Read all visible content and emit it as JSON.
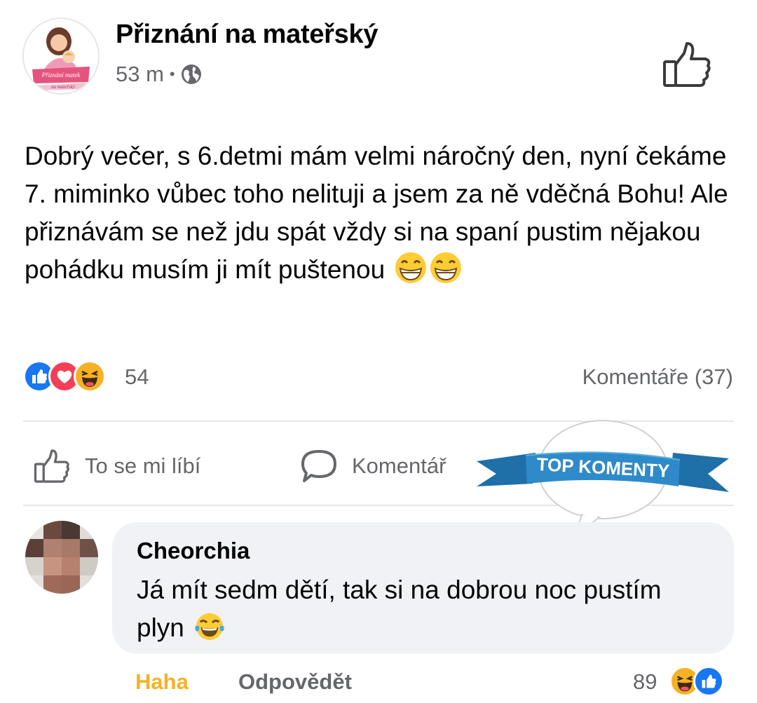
{
  "header": {
    "page_name": "Přiznání na mateřský",
    "time": "53 m",
    "separator": "•",
    "privacy_icon": "globe-icon",
    "logo_text_line1": "Přiznání matek",
    "logo_text_line2": "na mateřský"
  },
  "post": {
    "text": "Dobrý večer, s 6.detmi mám velmi náročný den, nyní čekáme 7. miminko vůbec toho nelituji a jsem za ně vděčná Bohu! Ale přiznávám se než jdu spát vždy si na spaní pustim nějakou pohádku musím ji mít puštenou",
    "emoji": [
      "grinning-face-icon",
      "grinning-face-icon"
    ]
  },
  "reactions": {
    "icons": [
      "like-reaction-icon",
      "love-reaction-icon",
      "haha-reaction-icon"
    ],
    "count": "54",
    "comments_label": "Komentáře (37)"
  },
  "actions": {
    "like_label": "To se mi líbí",
    "comment_label": "Komentář"
  },
  "ribbon": {
    "label": "TOP KOMENTY"
  },
  "comment": {
    "author": "Cheorchia",
    "text": "Já mít sedm dětí, tak si na dobrou noc pustím plyn",
    "haha_label": "Haha",
    "reply_label": "Odpovědět",
    "reaction_count": "89",
    "reaction_icons": [
      "haha-reaction-icon",
      "like-reaction-icon"
    ]
  },
  "colors": {
    "secondary_text": "#65676b",
    "like_blue": "#1877f2",
    "love_red": "#f33e58",
    "haha_yellow": "#f7b125",
    "ribbon_blue": "#2f8ac9"
  }
}
